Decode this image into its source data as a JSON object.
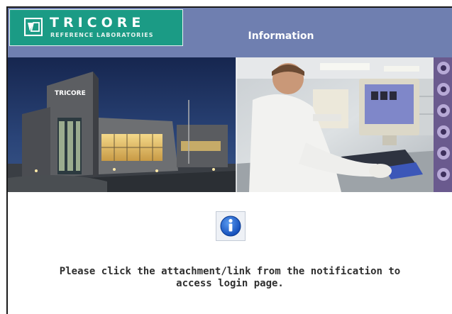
{
  "header": {
    "logo_name": "TRICORE",
    "logo_sub": "REFERENCE LABORATORIES",
    "title": "Information",
    "brand_color": "#1b9b85",
    "bar_color": "#6f7fb0"
  },
  "banner": {
    "building_sign": "TRICORE"
  },
  "content": {
    "icon": "info-icon",
    "message_line1": "Please click the attachment/link from the notification to",
    "message_line2": "access login page."
  }
}
